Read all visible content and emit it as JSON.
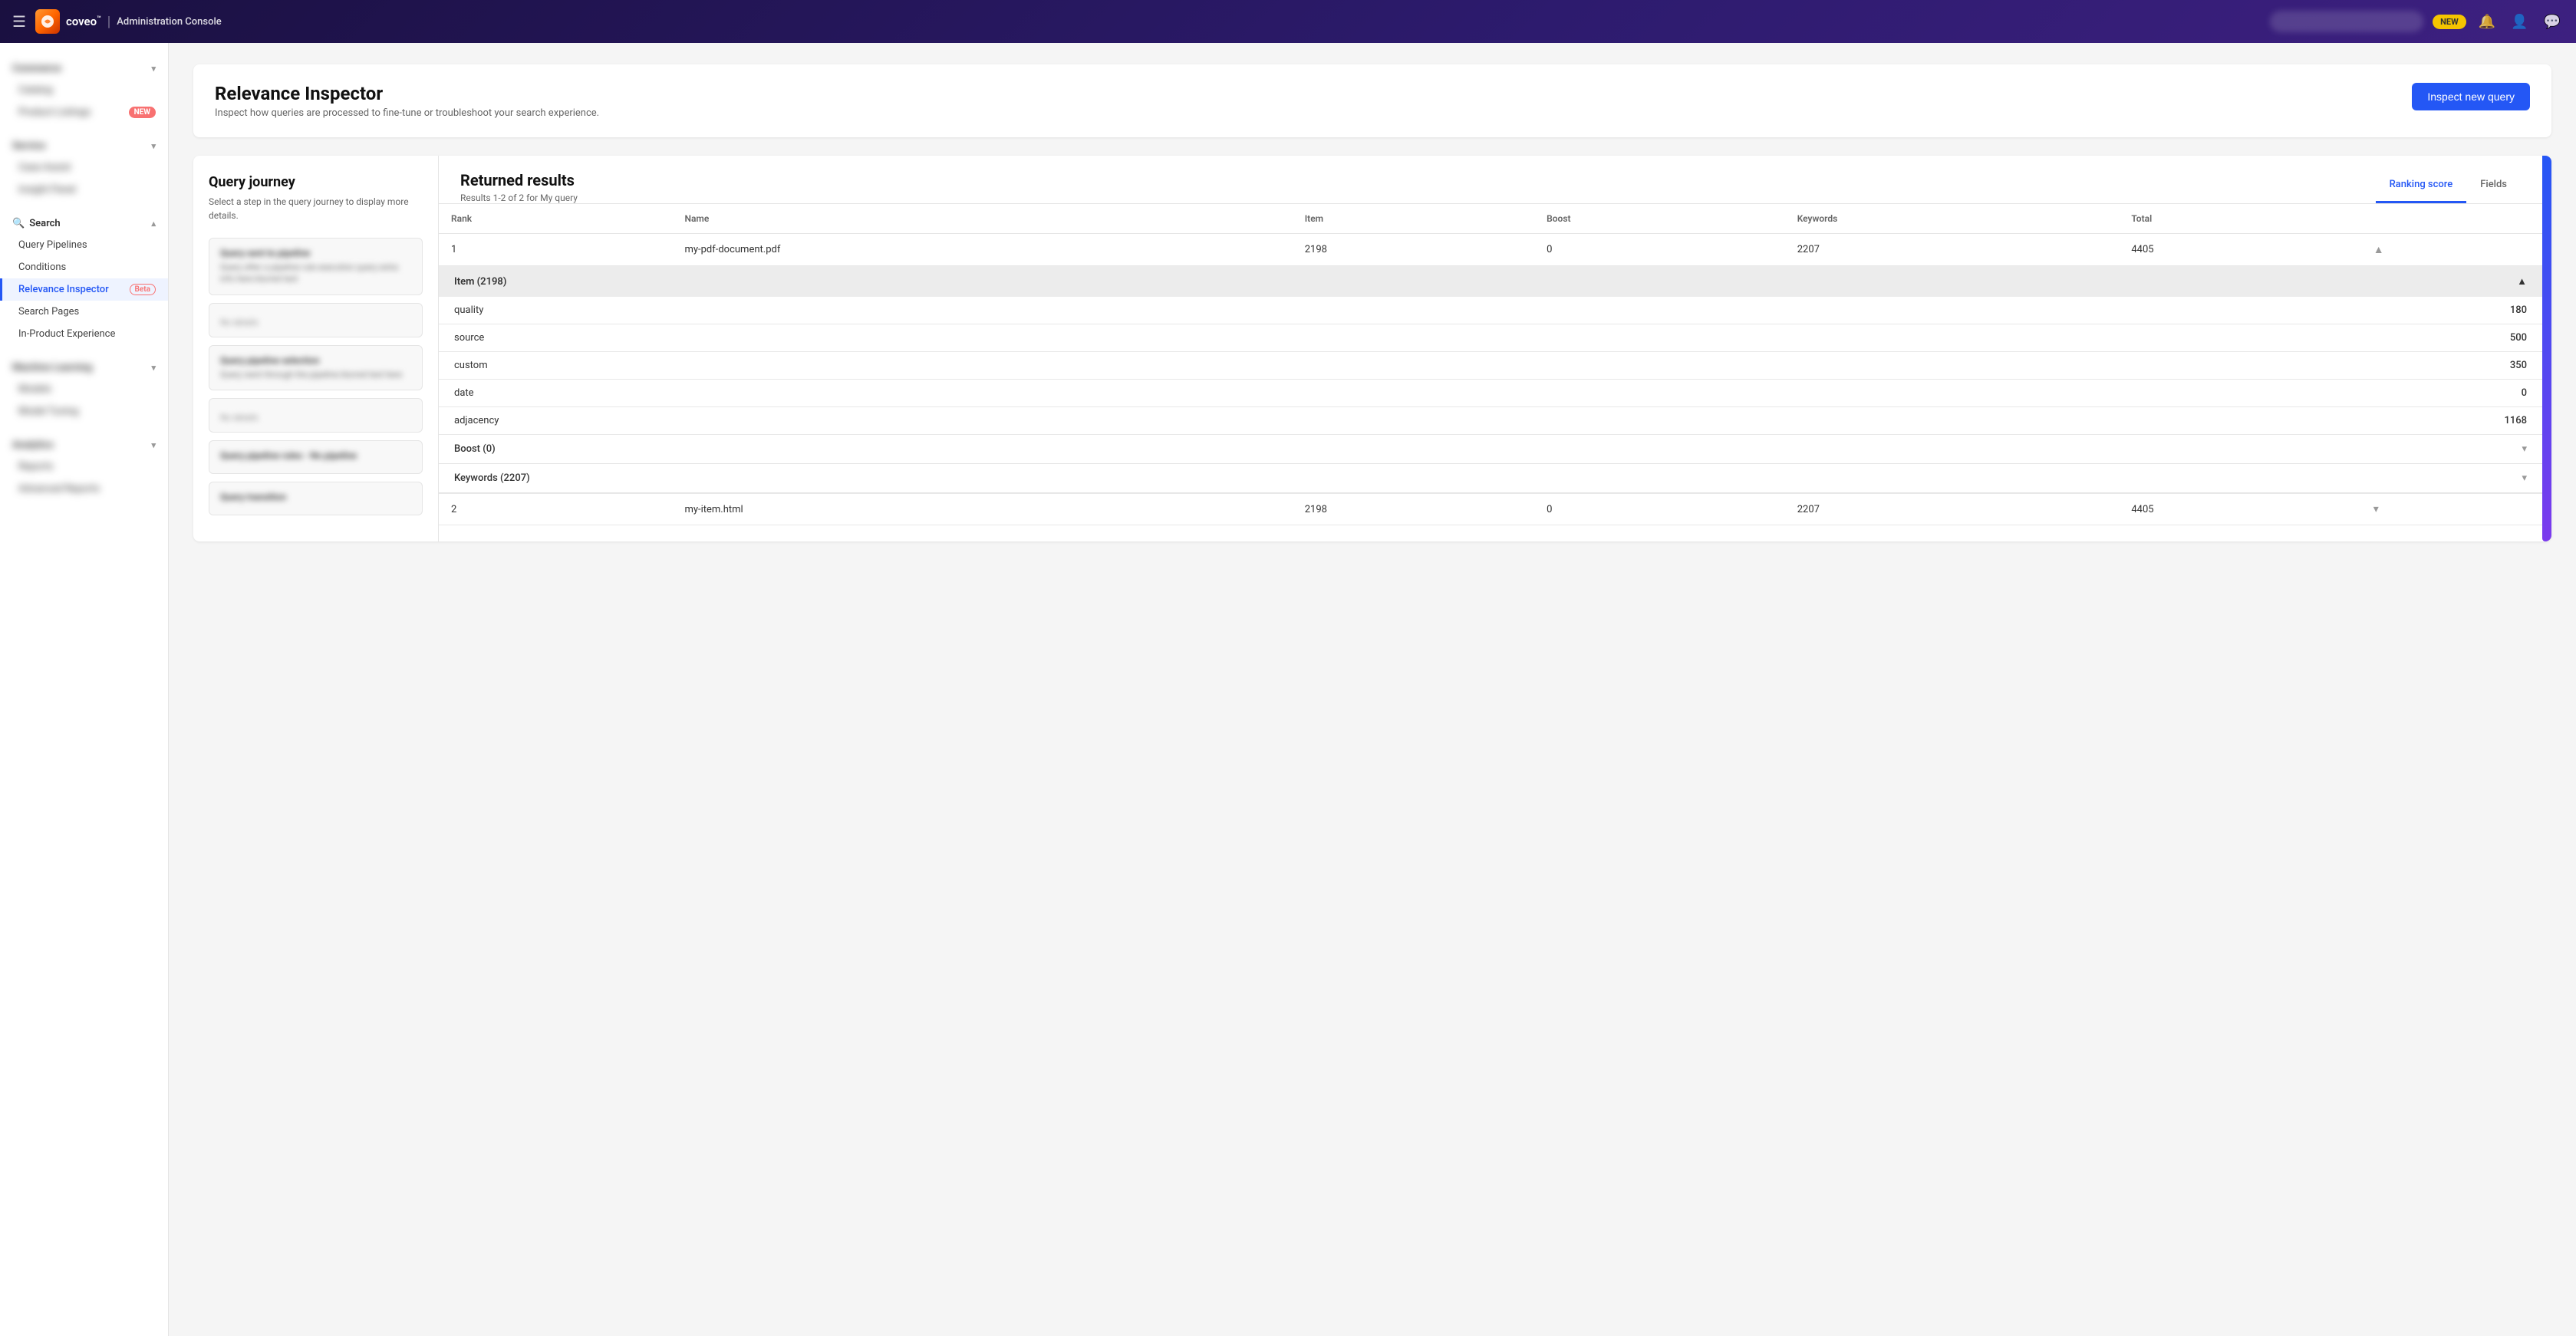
{
  "topnav": {
    "app_name": "Administration Console",
    "badge_label": "NEW",
    "notifications_icon": "🔔",
    "user_icon": "👤",
    "chat_icon": "💬",
    "hamburger_icon": "☰"
  },
  "sidebar": {
    "sections": [
      {
        "id": "commerce",
        "label": "Commerce",
        "blurred": true,
        "items": [
          {
            "id": "catalog",
            "label": "Catalog",
            "blurred": true,
            "active": false
          },
          {
            "id": "product-listings",
            "label": "Product Listings",
            "blurred": true,
            "active": false,
            "badge": "NEW"
          }
        ]
      },
      {
        "id": "service",
        "label": "Service",
        "blurred": true,
        "items": [
          {
            "id": "case-assist",
            "label": "Case Assist",
            "blurred": true,
            "active": false
          },
          {
            "id": "insight-panel",
            "label": "Insight Panel",
            "blurred": true,
            "active": false
          }
        ]
      },
      {
        "id": "search",
        "label": "Search",
        "blurred": false,
        "items": [
          {
            "id": "query-pipelines",
            "label": "Query Pipelines",
            "blurred": false,
            "active": false
          },
          {
            "id": "conditions",
            "label": "Conditions",
            "blurred": false,
            "active": false
          },
          {
            "id": "relevance-inspector",
            "label": "Relevance Inspector",
            "blurred": false,
            "active": true,
            "beta": true
          },
          {
            "id": "search-pages",
            "label": "Search Pages",
            "blurred": false,
            "active": false
          },
          {
            "id": "in-product-experience",
            "label": "In-Product Experience",
            "blurred": false,
            "active": false
          }
        ]
      },
      {
        "id": "machine-learning",
        "label": "Machine Learning",
        "blurred": true,
        "items": [
          {
            "id": "models",
            "label": "Models",
            "blurred": true,
            "active": false
          },
          {
            "id": "model-tuning",
            "label": "Model Tuning",
            "blurred": true,
            "active": false
          }
        ]
      },
      {
        "id": "analytics",
        "label": "Analytics",
        "blurred": true,
        "items": [
          {
            "id": "reports",
            "label": "Reports",
            "blurred": true,
            "active": false
          },
          {
            "id": "advanced-reports",
            "label": "Advanced Reports",
            "blurred": true,
            "active": false
          }
        ]
      }
    ]
  },
  "page": {
    "title": "Relevance Inspector",
    "subtitle": "Inspect how queries are processed to fine-tune or troubleshoot your search experience.",
    "inspect_btn": "Inspect new query"
  },
  "query_journey": {
    "title": "Query journey",
    "subtitle": "Select a step in the query journey to display more details.",
    "steps": [
      {
        "id": "step1",
        "title": "Query sent to pipeline",
        "detail": "Query after pipeline rule execution query extra info here"
      },
      {
        "id": "step2",
        "title": "No details",
        "detail": ""
      },
      {
        "id": "step3",
        "title": "Query pipeline selection",
        "detail": "Query went through the pipeline"
      },
      {
        "id": "step4",
        "title": "No details",
        "detail": ""
      },
      {
        "id": "step5",
        "title": "Query pipeline rules - No pipeline",
        "detail": ""
      },
      {
        "id": "step6",
        "title": "Query transition",
        "detail": ""
      }
    ]
  },
  "returned_results": {
    "title": "Returned results",
    "results_count": "Results 1-2 of 2 for My query",
    "tabs": [
      {
        "id": "ranking-score",
        "label": "Ranking score",
        "active": true
      },
      {
        "id": "fields",
        "label": "Fields",
        "active": false
      }
    ],
    "table": {
      "headers": [
        "Rank",
        "Name",
        "Item",
        "Boost",
        "Keywords",
        "Total"
      ],
      "rows": [
        {
          "rank": 1,
          "name": "my-pdf-document.pdf",
          "item": 2198,
          "boost": 0,
          "keywords": 2207,
          "total": 4405,
          "expanded": true
        },
        {
          "rank": 2,
          "name": "my-item.html",
          "item": 2198,
          "boost": 0,
          "keywords": 2207,
          "total": 4405,
          "expanded": false
        }
      ]
    },
    "expanded_item": {
      "section_label": "Item (2198)",
      "scores": [
        {
          "label": "quality",
          "value": 180
        },
        {
          "label": "source",
          "value": 500
        },
        {
          "label": "custom",
          "value": 350
        },
        {
          "label": "date",
          "value": 0
        },
        {
          "label": "adjacency",
          "value": 1168
        }
      ],
      "subsections": [
        {
          "label": "Boost (0)",
          "count": 0
        },
        {
          "label": "Keywords (2207)",
          "count": 2207
        }
      ]
    }
  }
}
